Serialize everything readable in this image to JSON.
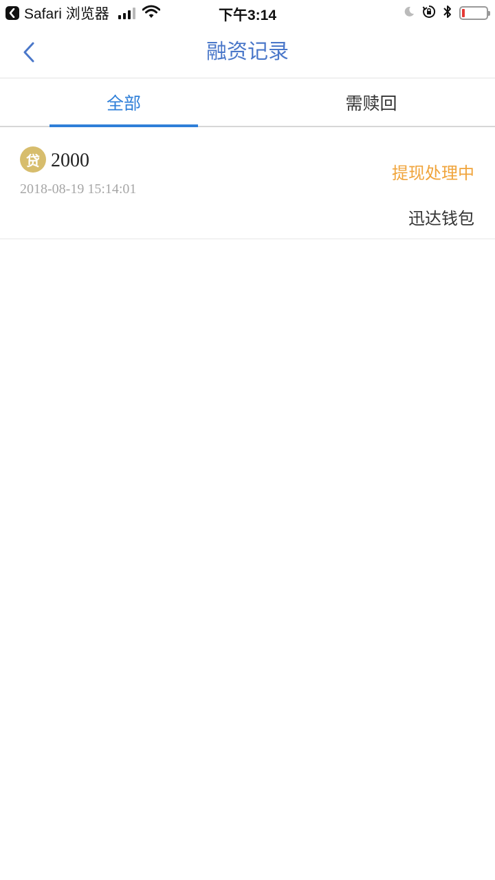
{
  "status_bar": {
    "app_name": "Safari 浏览器",
    "time": "下午3:14"
  },
  "nav": {
    "title": "融资记录"
  },
  "tabs": [
    {
      "label": "全部",
      "active": true
    },
    {
      "label": "需赎回",
      "active": false
    }
  ],
  "records": [
    {
      "badge": "贷",
      "amount": "2000",
      "date": "2018-08-19 15:14:01",
      "status": "提现处理中",
      "wallet": "迅达钱包"
    }
  ],
  "colors": {
    "accent": "#2f7fd8",
    "title": "#4a77c9",
    "status_pending": "#f0a43b",
    "badge": "#d7bd6d"
  },
  "icons": {
    "back": "chevron-left-icon",
    "return_app": "return-to-app-icon",
    "signal": "cell-signal-icon",
    "wifi": "wifi-icon",
    "moon": "do-not-disturb-icon",
    "rotation_lock": "rotation-lock-icon",
    "bluetooth": "bluetooth-icon",
    "battery": "battery-icon"
  },
  "battery_level": 0.12
}
